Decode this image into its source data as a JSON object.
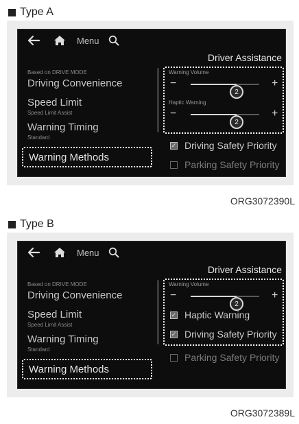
{
  "type_a": {
    "heading": "Type A",
    "nav": {
      "back_icon": "back-arrow-icon",
      "home_icon": "home-icon",
      "menu_label": "Menu",
      "search_icon": "search-icon"
    },
    "title": "Driver Assistance",
    "left_menu": {
      "mode_label": "Based on DRIVE MODE",
      "items": [
        {
          "label": "Driving Convenience"
        },
        {
          "label": "Speed Limit",
          "sub": "Speed Limit Assist"
        },
        {
          "label": "Warning Timing",
          "sub": "Standard"
        },
        {
          "label": "Warning Methods"
        }
      ]
    },
    "warning_volume": {
      "label": "Warning Volume",
      "minus": "−",
      "plus": "+",
      "value": "2",
      "level": 0.67
    },
    "haptic_warning": {
      "label": "Haptic Warning",
      "minus": "−",
      "plus": "+",
      "value": "2",
      "level": 0.67
    },
    "checks": [
      {
        "label": "Driving Safety Priority",
        "checked": true
      },
      {
        "label": "Parking Safety Priority",
        "checked": false
      }
    ],
    "code": "ORG3072390L"
  },
  "type_b": {
    "heading": "Type B",
    "nav": {
      "back_icon": "back-arrow-icon",
      "home_icon": "home-icon",
      "menu_label": "Menu",
      "search_icon": "search-icon"
    },
    "title": "Driver Assistance",
    "left_menu": {
      "mode_label": "Based on DRIVE MODE",
      "items": [
        {
          "label": "Driving Convenience"
        },
        {
          "label": "Speed Limit",
          "sub": "Speed Limit Assist"
        },
        {
          "label": "Warning Timing",
          "sub": "Standard"
        },
        {
          "label": "Warning Methods"
        }
      ]
    },
    "warning_volume": {
      "label": "Warning Volume",
      "minus": "−",
      "plus": "+",
      "value": "2",
      "level": 0.67
    },
    "checks": [
      {
        "label": "Haptic Warning",
        "checked": true
      },
      {
        "label": "Driving Safety Priority",
        "checked": true
      },
      {
        "label": "Parking Safety Priority",
        "checked": false
      }
    ],
    "code": "ORG3072389L"
  },
  "colors": {
    "screen_bg": "#0d0d0d",
    "panel_bg": "#ececec",
    "highlight_border": "#ffffff",
    "text_light": "#c8c8c8"
  }
}
